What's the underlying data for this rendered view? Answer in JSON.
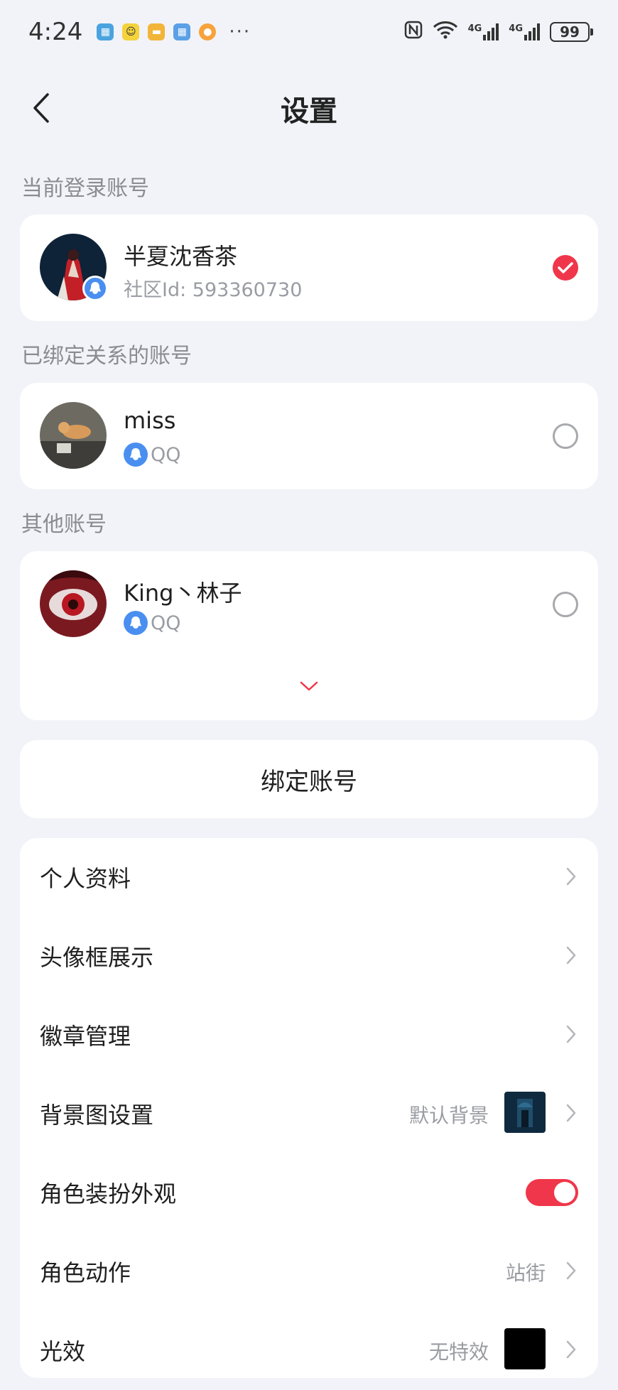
{
  "status_bar": {
    "time": "4:24",
    "network_label_1": "4G",
    "network_label_2": "4G",
    "battery": "99"
  },
  "header": {
    "title": "设置"
  },
  "current_account": {
    "section_label": "当前登录账号",
    "name": "半夏沈香茶",
    "community_id": "社区Id: 593360730"
  },
  "linked_accounts": {
    "section_label": "已绑定关系的账号",
    "items": [
      {
        "name": "miss",
        "platform": "QQ"
      }
    ]
  },
  "other_accounts": {
    "section_label": "其他账号",
    "items": [
      {
        "name": "King丶林子",
        "platform": "QQ"
      }
    ]
  },
  "bind_button": {
    "label": "绑定账号"
  },
  "menu": {
    "items": [
      {
        "label": "个人资料"
      },
      {
        "label": "头像框展示"
      },
      {
        "label": "徽章管理"
      },
      {
        "label": "背景图设置",
        "value": "默认背景"
      },
      {
        "label": "角色装扮外观",
        "toggle_on": true
      },
      {
        "label": "角色动作",
        "value": "站街"
      },
      {
        "label": "光效",
        "value": "无特效"
      }
    ]
  },
  "colors": {
    "accent": "#f0364a",
    "qq_blue": "#4a8ff0",
    "background": "#f1f3f8"
  }
}
